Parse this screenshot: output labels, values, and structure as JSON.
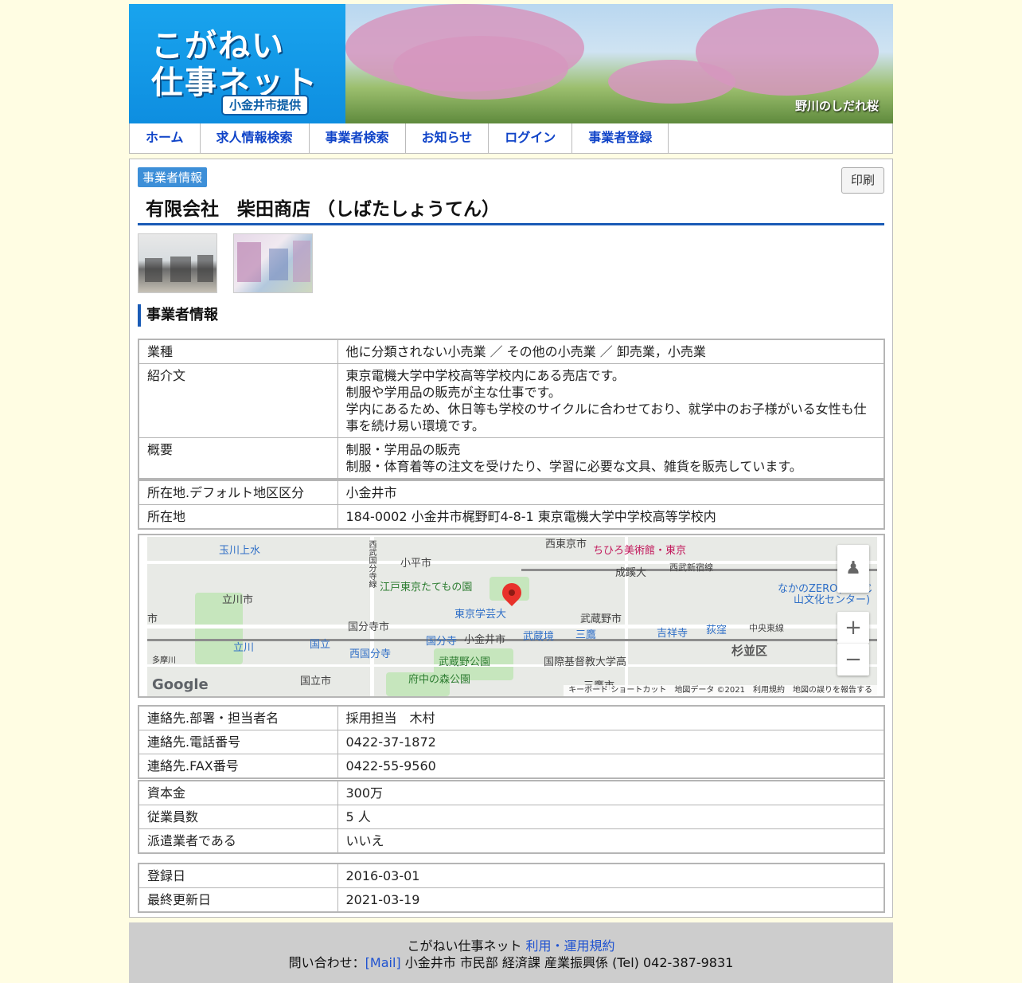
{
  "banner": {
    "logo_line1": "こがねい",
    "logo_line2": "仕事ネット",
    "logo_badge": "小金井市提供",
    "photo_caption": "野川のしだれ桜"
  },
  "nav": {
    "items": [
      "ホーム",
      "求人情報検索",
      "事業者検索",
      "お知らせ",
      "ログイン",
      "事業者登録"
    ]
  },
  "page": {
    "tag": "事業者情報",
    "print_label": "印刷",
    "title": "有限会社　柴田商店 （しばたしょうてん）",
    "section_heading": "事業者情報"
  },
  "table1": [
    {
      "key": "業種",
      "lines": [
        "他に分類されない小売業 ／ その他の小売業 ／ 卸売業，小売業"
      ]
    },
    {
      "key": "紹介文",
      "lines": [
        "東京電機大学中学校高等学校内にある売店です。",
        "制服や学用品の販売が主な仕事です。",
        "学内にあるため、休日等も学校のサイクルに合わせており、就学中のお子様がいる女性も仕",
        "事を続け易い環境です。"
      ]
    },
    {
      "key": "概要",
      "lines": [
        "制服・学用品の販売",
        "制服・体育着等の注文を受けたり、学習に必要な文具、雑貨を販売しています。"
      ]
    }
  ],
  "table2": [
    {
      "key": "所在地.デフォルト地区区分",
      "value": "小金井市"
    },
    {
      "key": "所在地",
      "value": "184-0002 小金井市梶野町4-8-1 東京電機大学中学校高等学校内"
    }
  ],
  "map": {
    "labels": {
      "tamagawa": "玉川上水",
      "nishitokyo": "西東京市",
      "chihiro": "ちひろ美術館・東京",
      "kodaira": "小平市",
      "seikei": "成蹊大",
      "seibu_shinjuku": "西武新宿線",
      "nakano_zero": "なかのZERO(もみじ",
      "nakano_zero2": "山文化センター)",
      "tachikawa_city": "立川市",
      "edo_tokyo": "江戸東京たてもの園",
      "gakugei": "東京学芸大",
      "musashino_city": "武蔵野市",
      "kokubunji_city": "国分寺市",
      "koganei_city": "小金井市",
      "musashisakai": "武蔵境",
      "mitaka": "三鷹",
      "kichijoji": "吉祥寺",
      "ogikubo": "荻窪",
      "chuo_line": "中央東線",
      "suginami": "杉並区",
      "tachikawa": "立川",
      "kunitachi": "国立",
      "kokubunji": "国分寺",
      "nishikokubunji": "西国分寺",
      "musashino_park": "武蔵野公園",
      "icu": "国際基督教大学高",
      "fuchu_park": "府中の森公園",
      "kunitachi_city": "国立市",
      "mitaka_city": "三鷹市",
      "shi_left": "市",
      "nishikokubunji_road": "西武国分寺線",
      "tamagawa_river": "多摩川"
    },
    "google": "Google",
    "footer_text": "キーボード ショートカット　地図データ ©2021　利用規約　地図の誤りを報告する"
  },
  "table3": [
    {
      "key": "連絡先.部署・担当者名",
      "value": "採用担当　木村"
    },
    {
      "key": "連絡先.電話番号",
      "value": "0422-37-1872"
    },
    {
      "key": "連絡先.FAX番号",
      "value": "0422-55-9560"
    }
  ],
  "table4": [
    {
      "key": "資本金",
      "value": "300万"
    },
    {
      "key": "従業員数",
      "value": "5 人"
    },
    {
      "key": "派遣業者である",
      "value": "いいえ"
    }
  ],
  "table5": [
    {
      "key": "登録日",
      "value": "2016-03-01"
    },
    {
      "key": "最終更新日",
      "value": "2021-03-19"
    }
  ],
  "footer": {
    "site_name": "こがねい仕事ネット",
    "terms_link": "利用・運用規約",
    "contact_prefix": "問い合わせ：",
    "mail_link": "[Mail]",
    "contact_rest": "小金井市 市民部 経済課 産業振興係 (Tel) 042-387-9831"
  }
}
